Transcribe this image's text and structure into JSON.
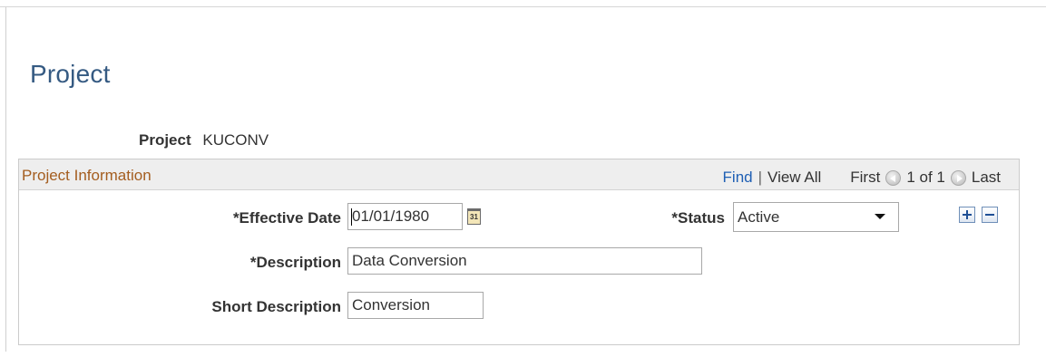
{
  "page": {
    "title": "Project"
  },
  "project": {
    "label": "Project",
    "value": "KUCONV"
  },
  "group": {
    "title": "Project Information",
    "nav": {
      "find": "Find",
      "separator": "|",
      "view_all": "View All",
      "first": "First",
      "count": "1 of 1",
      "last": "Last"
    }
  },
  "fields": {
    "effective_date": {
      "label": "*Effective Date",
      "value": "01/01/1980"
    },
    "calendar_icon_text": "31",
    "status": {
      "label": "*Status",
      "value": "Active"
    },
    "description": {
      "label": "*Description",
      "value": "Data Conversion"
    },
    "short_description": {
      "label": "Short Description",
      "value": "Conversion"
    }
  },
  "colors": {
    "title": "#355a82",
    "group_title": "#a45d1f",
    "link": "#1e5fb4",
    "header_bg": "#eeeeee"
  },
  "icons": [
    "calendar-icon",
    "previous-arrow-icon",
    "next-arrow-icon",
    "add-row-icon",
    "delete-row-icon",
    "dropdown-arrow-icon"
  ]
}
